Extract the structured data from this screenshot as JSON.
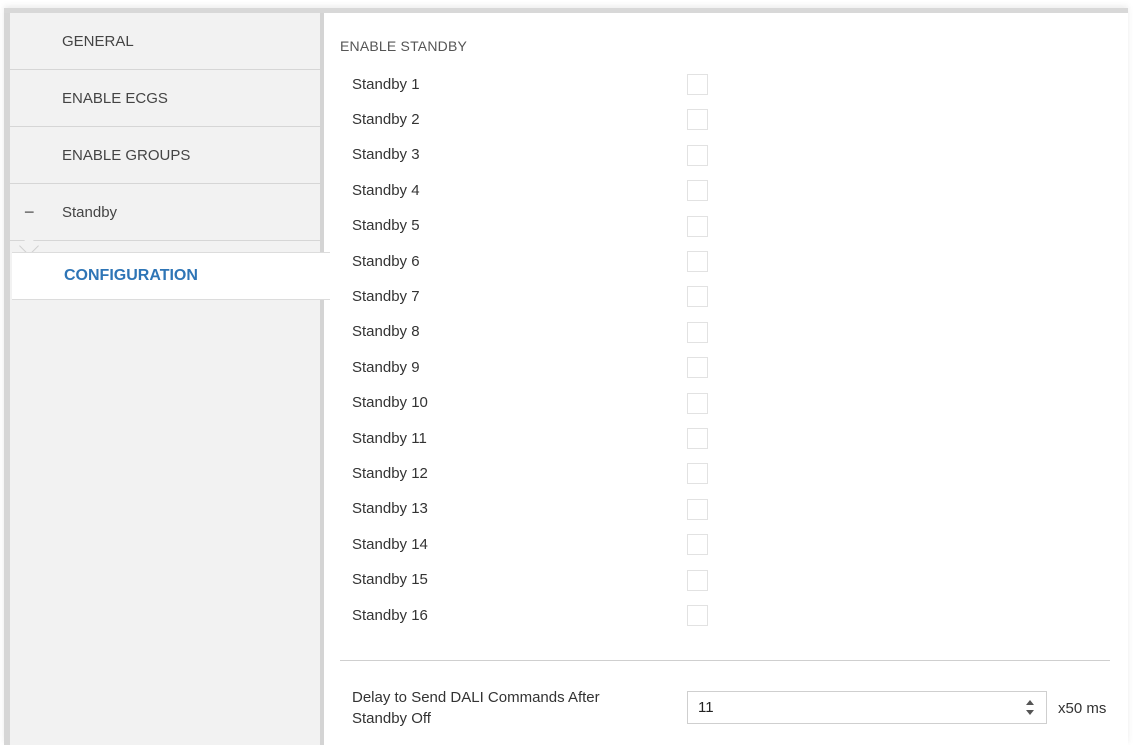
{
  "sidebar": {
    "items": [
      {
        "label": "GENERAL"
      },
      {
        "label": "ENABLE ECGS"
      },
      {
        "label": "ENABLE GROUPS"
      },
      {
        "label": "Standby",
        "prefix": "−"
      }
    ],
    "sub_item": {
      "label": "CONFIGURATION"
    }
  },
  "main": {
    "section_title": "ENABLE STANDBY",
    "standby_rows": [
      {
        "label": "Standby 1",
        "checked": false
      },
      {
        "label": "Standby 2",
        "checked": false
      },
      {
        "label": "Standby 3",
        "checked": false
      },
      {
        "label": "Standby 4",
        "checked": false
      },
      {
        "label": "Standby 5",
        "checked": false
      },
      {
        "label": "Standby 6",
        "checked": false
      },
      {
        "label": "Standby 7",
        "checked": false
      },
      {
        "label": "Standby 8",
        "checked": false
      },
      {
        "label": "Standby 9",
        "checked": false
      },
      {
        "label": "Standby 10",
        "checked": false
      },
      {
        "label": "Standby 11",
        "checked": false
      },
      {
        "label": "Standby 12",
        "checked": false
      },
      {
        "label": "Standby 13",
        "checked": false
      },
      {
        "label": "Standby 14",
        "checked": false
      },
      {
        "label": "Standby 15",
        "checked": false
      },
      {
        "label": "Standby 16",
        "checked": false
      }
    ],
    "delay": {
      "label": "Delay to Send DALI Commands After Standby Off",
      "value": "11",
      "unit": "x50 ms"
    }
  },
  "colors": {
    "accent": "#2e75b6",
    "sidebar_bg": "#f2f2f2"
  }
}
